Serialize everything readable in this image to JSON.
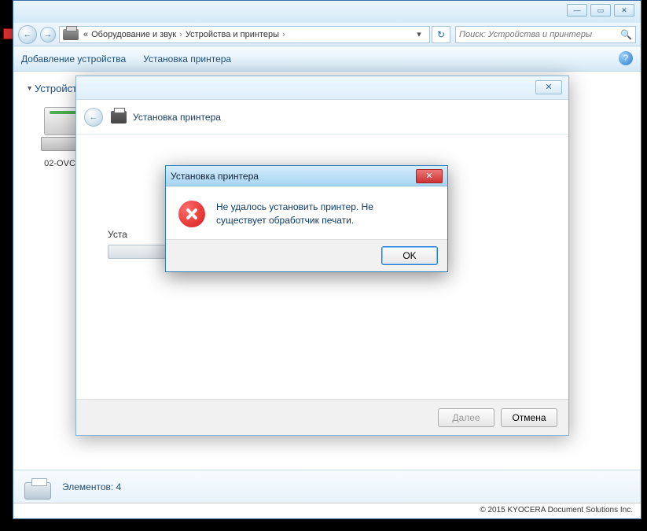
{
  "desktop": {
    "red_app": "app"
  },
  "explorer": {
    "window_buttons": {
      "min": "—",
      "max": "▭",
      "close": "✕"
    },
    "nav": {
      "back": "←",
      "fwd": "→"
    },
    "breadcrumb": {
      "prefix_chevron": "«",
      "seg1": "Оборудование и звук",
      "seg2": "Устройства и принтеры",
      "sep": "›",
      "dropdown": "▾"
    },
    "refresh": "↻",
    "search": {
      "placeholder": "Поиск: Устройства и принтеры",
      "icon": "🔍"
    },
    "commands": {
      "add_device": "Добавление устройства",
      "add_printer": "Установка принтера",
      "help": "?"
    },
    "group_header": "Устройства",
    "device_name": "02-OVCH",
    "status": {
      "label": "Элементов:",
      "count": "4"
    },
    "copyright": "© 2015 KYOCERA Document Solutions Inc."
  },
  "wizard": {
    "window_close": "✕",
    "back": "←",
    "title": "Установка принтера",
    "body_label_prefix": "Уста",
    "footer": {
      "next": "Далее",
      "cancel": "Отмена"
    }
  },
  "msgbox": {
    "title": "Установка принтера",
    "close": "✕",
    "text_line1": "Не удалось установить принтер. Не",
    "text_line2": "существует обработчик печати.",
    "ok": "OK"
  }
}
